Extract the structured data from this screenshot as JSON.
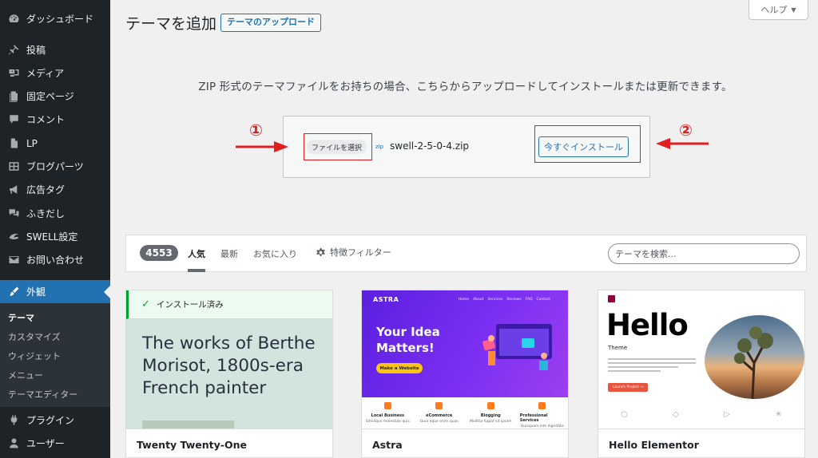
{
  "sidebar": {
    "items": [
      {
        "label": "ダッシュボード",
        "icon": "dashboard-icon"
      },
      {
        "label": "投稿",
        "icon": "pin-icon"
      },
      {
        "label": "メディア",
        "icon": "media-icon"
      },
      {
        "label": "固定ページ",
        "icon": "page-icon"
      },
      {
        "label": "コメント",
        "icon": "comment-icon"
      },
      {
        "label": "LP",
        "icon": "document-icon"
      },
      {
        "label": "ブログパーツ",
        "icon": "grid-icon"
      },
      {
        "label": "広告タグ",
        "icon": "megaphone-icon"
      },
      {
        "label": "ふきだし",
        "icon": "speech-bubbles-icon"
      },
      {
        "label": "SWELL設定",
        "icon": "swell-icon"
      },
      {
        "label": "お問い合わせ",
        "icon": "mail-icon"
      },
      {
        "label": "外観",
        "icon": "paintbrush-icon"
      },
      {
        "label": "プラグイン",
        "icon": "plugin-icon"
      },
      {
        "label": "ユーザー",
        "icon": "user-icon"
      }
    ],
    "submenu": [
      "テーマ",
      "カスタマイズ",
      "ウィジェット",
      "メニュー",
      "テーマエディター"
    ]
  },
  "header": {
    "title": "テーマを追加",
    "upload_button": "テーマのアップロード",
    "help_button": "ヘルプ"
  },
  "upload": {
    "description": "ZIP 形式のテーマファイルをお持ちの場合、こちらからアップロードしてインストールまたは更新できます。",
    "choose_file_button": "ファイルを選択",
    "zip_label": "zip",
    "file_name": "swell-2-5-0-4.zip",
    "install_button": "今すぐインストール",
    "annotation_1": "①",
    "annotation_2": "②"
  },
  "filter": {
    "count": "4553",
    "tabs": [
      "人気",
      "最新",
      "お気に入り"
    ],
    "feature_filter": "特徴フィルター",
    "search_placeholder": "テーマを検索..."
  },
  "themes": [
    {
      "name": "Twenty Twenty-One",
      "installed_label": "インストール済み",
      "headline": "The works of Berthe Morisot, 1800s-era French painter"
    },
    {
      "name": "Astra",
      "logo": "ASTRA",
      "nav": [
        "Home",
        "About",
        "Services",
        "Reviews",
        "FAQ",
        "Contact"
      ],
      "hero_title": "Your Idea Matters!",
      "cta": "Make a Website",
      "services": [
        {
          "title": "Local Business",
          "text": "Similique molestiae quis"
        },
        {
          "title": "eCommerce",
          "text": "Quia eque enim quas"
        },
        {
          "title": "Blogging",
          "text": "Mollitia fugiat sit ipsam"
        },
        {
          "title": "Professional Services",
          "text": "Quisquam iste dignitate"
        }
      ]
    },
    {
      "name": "Hello Elementor",
      "hero_title": "Hello",
      "subtitle": "Theme",
      "cta": "Launch Project →"
    }
  ],
  "colors": {
    "sidebar_bg": "#1d2327",
    "accent": "#2271b1",
    "annotation_red": "#e02020",
    "installed_green": "#00a32a"
  }
}
